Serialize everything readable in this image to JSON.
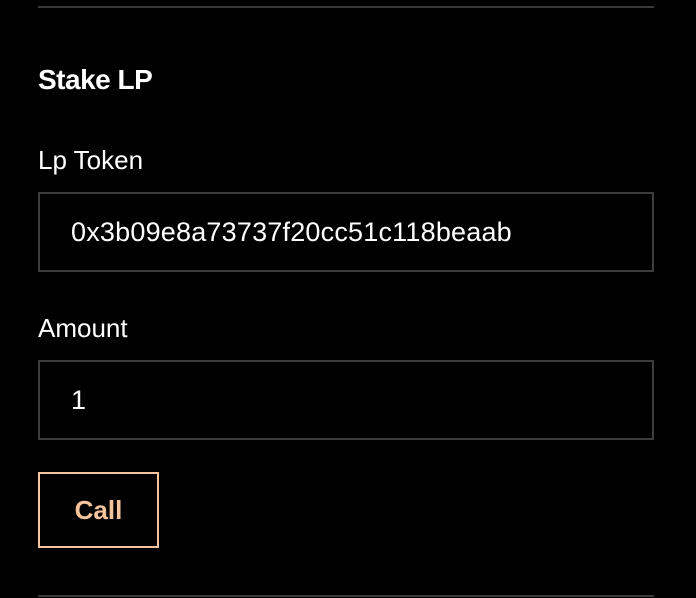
{
  "section": {
    "title": "Stake LP"
  },
  "fields": {
    "lp_token": {
      "label": "Lp Token",
      "value": "0x3b09e8a73737f20cc51c118beaab"
    },
    "amount": {
      "label": "Amount",
      "value": "1"
    }
  },
  "actions": {
    "call_label": "Call"
  },
  "colors": {
    "background": "#000000",
    "text": "#ffffff",
    "border": "#3d3d3d",
    "accent": "#f4c49c"
  }
}
